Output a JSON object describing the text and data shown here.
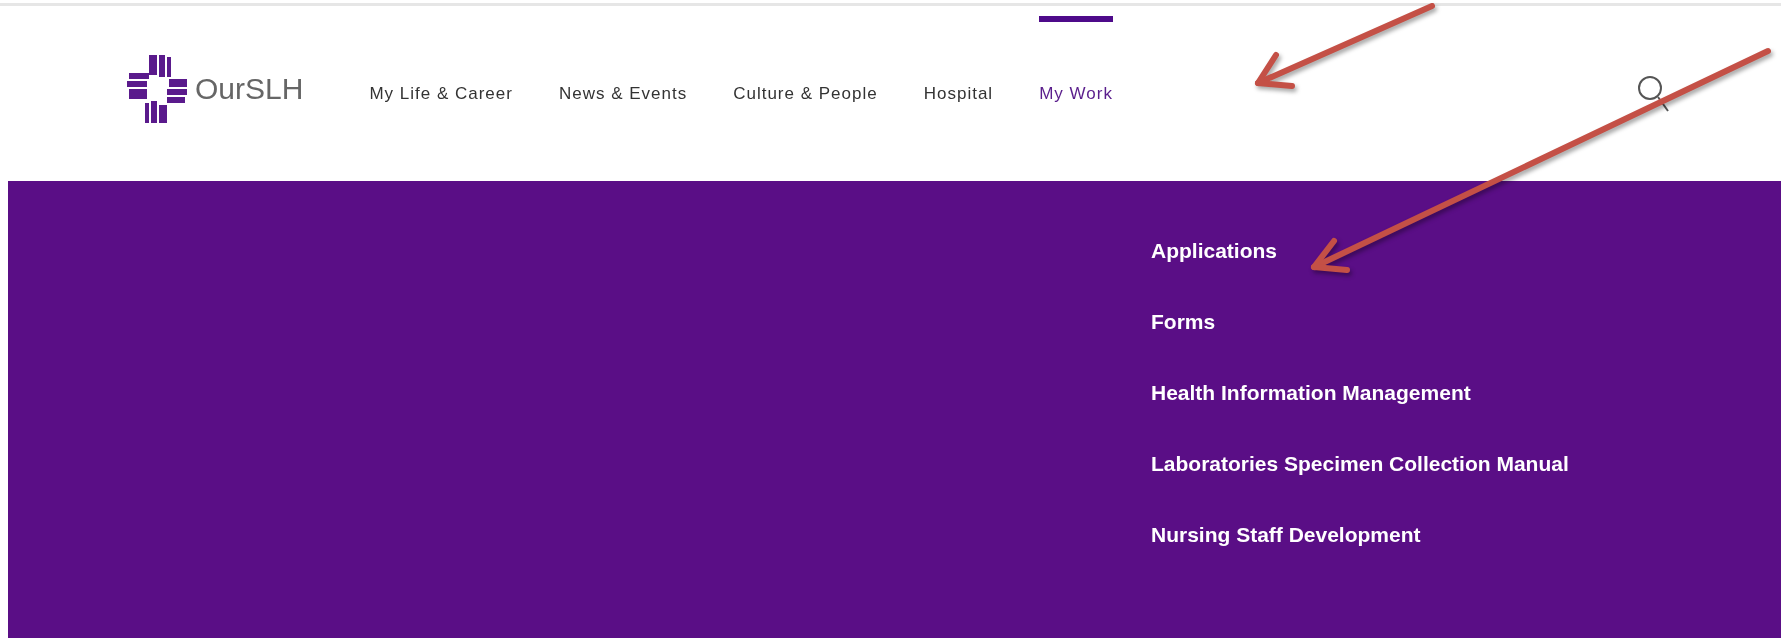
{
  "logo": {
    "text": "OurSLH"
  },
  "nav": [
    {
      "label": "My Life & Career",
      "selected": false
    },
    {
      "label": "News & Events",
      "selected": false
    },
    {
      "label": "Culture & People",
      "selected": false
    },
    {
      "label": "Hospital",
      "selected": false
    },
    {
      "label": "My Work",
      "selected": true
    }
  ],
  "dropdown": {
    "items": [
      "Applications",
      "Forms",
      "Health Information Management",
      "Laboratories Specimen Collection Manual",
      "Nursing Staff Development"
    ]
  }
}
